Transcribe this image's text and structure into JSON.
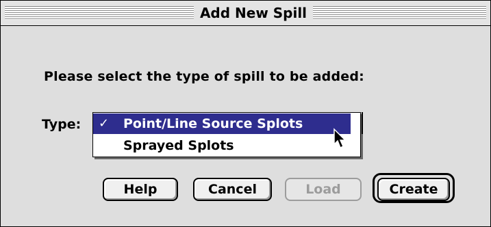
{
  "window": {
    "title": "Add New Spill"
  },
  "dialog": {
    "prompt": "Please select the type of spill to be added:",
    "type_label": "Type:",
    "type_options": [
      {
        "label": "Point/Line Source Splots",
        "selected": true,
        "mark": "✓"
      },
      {
        "label": "Sprayed Splots",
        "selected": false,
        "mark": ""
      }
    ]
  },
  "buttons": {
    "help": "Help",
    "cancel": "Cancel",
    "load": "Load",
    "create": "Create"
  },
  "icons": {
    "cursor": "arrow-cursor-icon",
    "check": "checkmark-icon"
  },
  "colors": {
    "selection": "#2e2d8e",
    "window_bg": "#dedede",
    "disabled_text": "#9c9c9c"
  }
}
